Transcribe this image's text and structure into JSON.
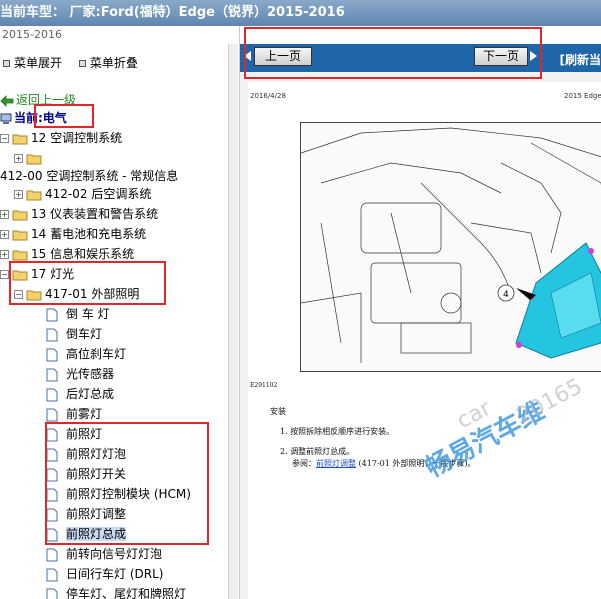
{
  "window": {
    "title": "当前车型： 厂家:Ford(福特）Edge（锐界）2015-2016"
  },
  "left_panel": {
    "subtitle": "2015-2016",
    "menu_expand": "菜单展开",
    "menu_collapse": "菜单折叠",
    "back": "返回上一级",
    "current": "当前:电气",
    "tree": [
      {
        "label": "12 空调控制系统"
      },
      {
        "label": ""
      },
      {
        "label": "412-00 空调控制系统 - 常规信息"
      },
      {
        "label": "412-02 后空调系统"
      },
      {
        "label": "13 仪表装置和警告系统"
      },
      {
        "label": "14 蓄电池和充电系统"
      },
      {
        "label": "15 信息和娱乐系统"
      },
      {
        "label": "17 灯光"
      },
      {
        "label": "417-01 外部照明"
      },
      {
        "label": "倒 车 灯"
      },
      {
        "label": "倒车灯"
      },
      {
        "label": "高位刹车灯"
      },
      {
        "label": "光传感器"
      },
      {
        "label": "后灯总成"
      },
      {
        "label": "前雾灯"
      },
      {
        "label": "前照灯"
      },
      {
        "label": "前照灯灯泡"
      },
      {
        "label": "前照灯开关"
      },
      {
        "label": "前照灯控制模块 (HCM)"
      },
      {
        "label": "前照灯调整"
      },
      {
        "label": "前照灯总成"
      },
      {
        "label": "前转向信号灯灯泡"
      },
      {
        "label": "日间行车灯 (DRL)"
      },
      {
        "label": "停车灯、尾灯和牌照灯"
      }
    ]
  },
  "right_panel": {
    "prev_page": "上一页",
    "next_page": "下一页",
    "refresh": "[刷新当",
    "doc": {
      "date": "2016/4/28",
      "header_right": "2015 Edge [",
      "figure_code": "E291102",
      "section": "安装",
      "step1": "按照拆除相反顺序进行安装。",
      "step2": "调整前照灯总成。",
      "step2_ref_prefix": "参阅：",
      "step2_ref_link": "前照灯调整",
      "step2_ref_suffix": "(417-01 外部照明，一般步骤)。",
      "callout": "4",
      "watermark_main": "畅易汽车维",
      "watermark_sub1": "car",
      "watermark_sub2": "20165"
    }
  },
  "colors": {
    "title_bar": "#6f93bb",
    "nav_bar": "#1e66a8",
    "highlight": "#e0282b",
    "selected_row": "#c9d9ef",
    "back_link": "#228b22",
    "current_label": "#00008b"
  },
  "icons": [
    "back-arrow-icon",
    "computer-icon",
    "folder-icon",
    "document-icon",
    "expand-icon",
    "collapse-icon"
  ]
}
